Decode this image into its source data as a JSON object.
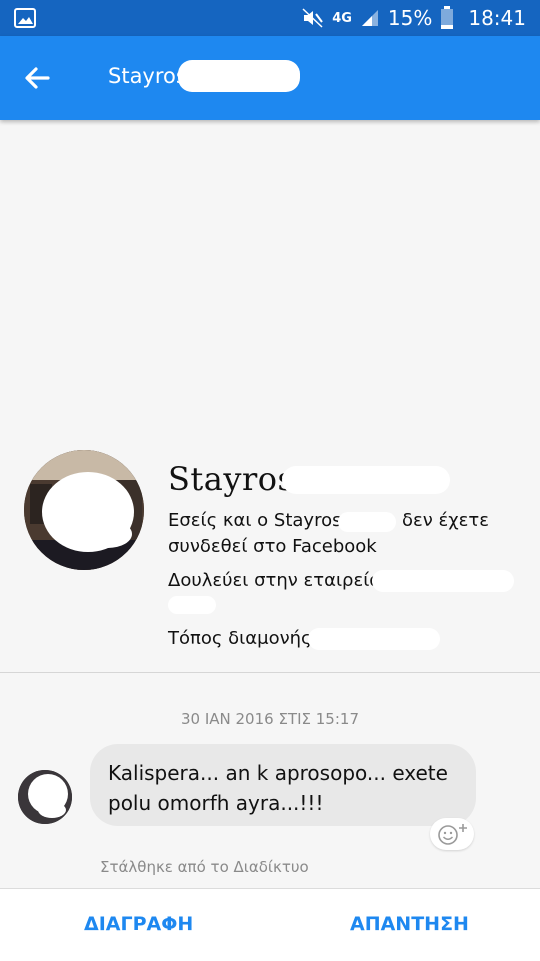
{
  "status_bar": {
    "network": "4G",
    "battery": "15%",
    "time": "18:41"
  },
  "app_bar": {
    "title": "Stayros",
    "back_icon": "back-arrow-icon"
  },
  "profile": {
    "name": "Stayros",
    "connection_text_line1": "Εσείς και ο Stayros",
    "connection_text_line1_end": "δεν έχετε",
    "connection_text_line2": "συνδεθεί στο Facebook",
    "works_at": "Δουλεύει στην εταιρεία",
    "lives_in": "Τόπος διαμονής:"
  },
  "conversation": {
    "date": "30 ΙΑΝ 2016 ΣΤΙΣ 15:17",
    "message_line1": "Kalispera... an k aprosopo... exete",
    "message_line2": "polu omorfh ayra...!!!",
    "sent_via": "Στάλθηκε από το Διαδίκτυο"
  },
  "actions": {
    "delete": "ΔΙΑΓΡΑΦΗ",
    "reply": "ΑΠΑΝΤΗΣΗ"
  },
  "colors": {
    "status_bar": "#1565c0",
    "app_bar": "#1e88f0",
    "accent": "#1e88f0"
  }
}
